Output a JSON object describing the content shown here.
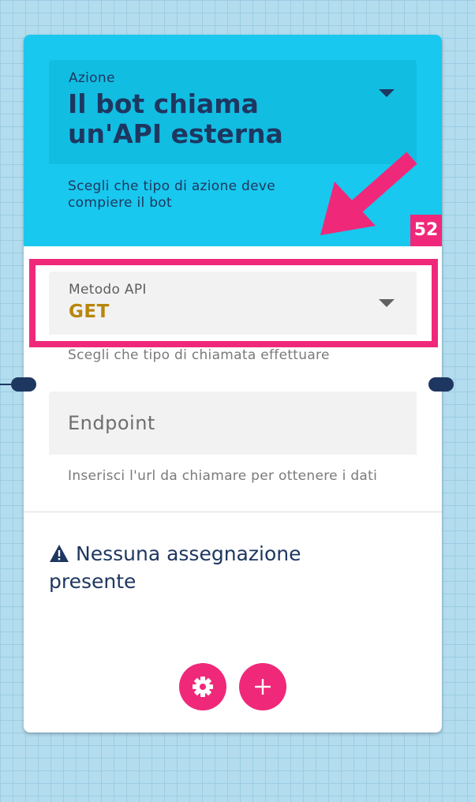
{
  "action": {
    "label": "Azione",
    "value": "Il bot chiama un'API esterna",
    "helper": "Scegli che tipo di azione deve compiere il bot"
  },
  "node": {
    "id": "52"
  },
  "method": {
    "label": "Metodo API",
    "value": "GET",
    "helper": "Scegli che tipo di chiamata effettuare"
  },
  "endpoint": {
    "placeholder": "Endpoint",
    "value": "",
    "helper": "Inserisci l'url da chiamare per ottenere i dati"
  },
  "assignments": {
    "empty_message": "Nessuna assegnazione presente"
  },
  "actions": {
    "settings_icon": "gear-icon",
    "add_icon": "plus-icon"
  },
  "colors": {
    "accent": "#f0287a",
    "header": "#18c8ee",
    "text_dark": "#1e3760",
    "method_value": "#b8860b"
  }
}
